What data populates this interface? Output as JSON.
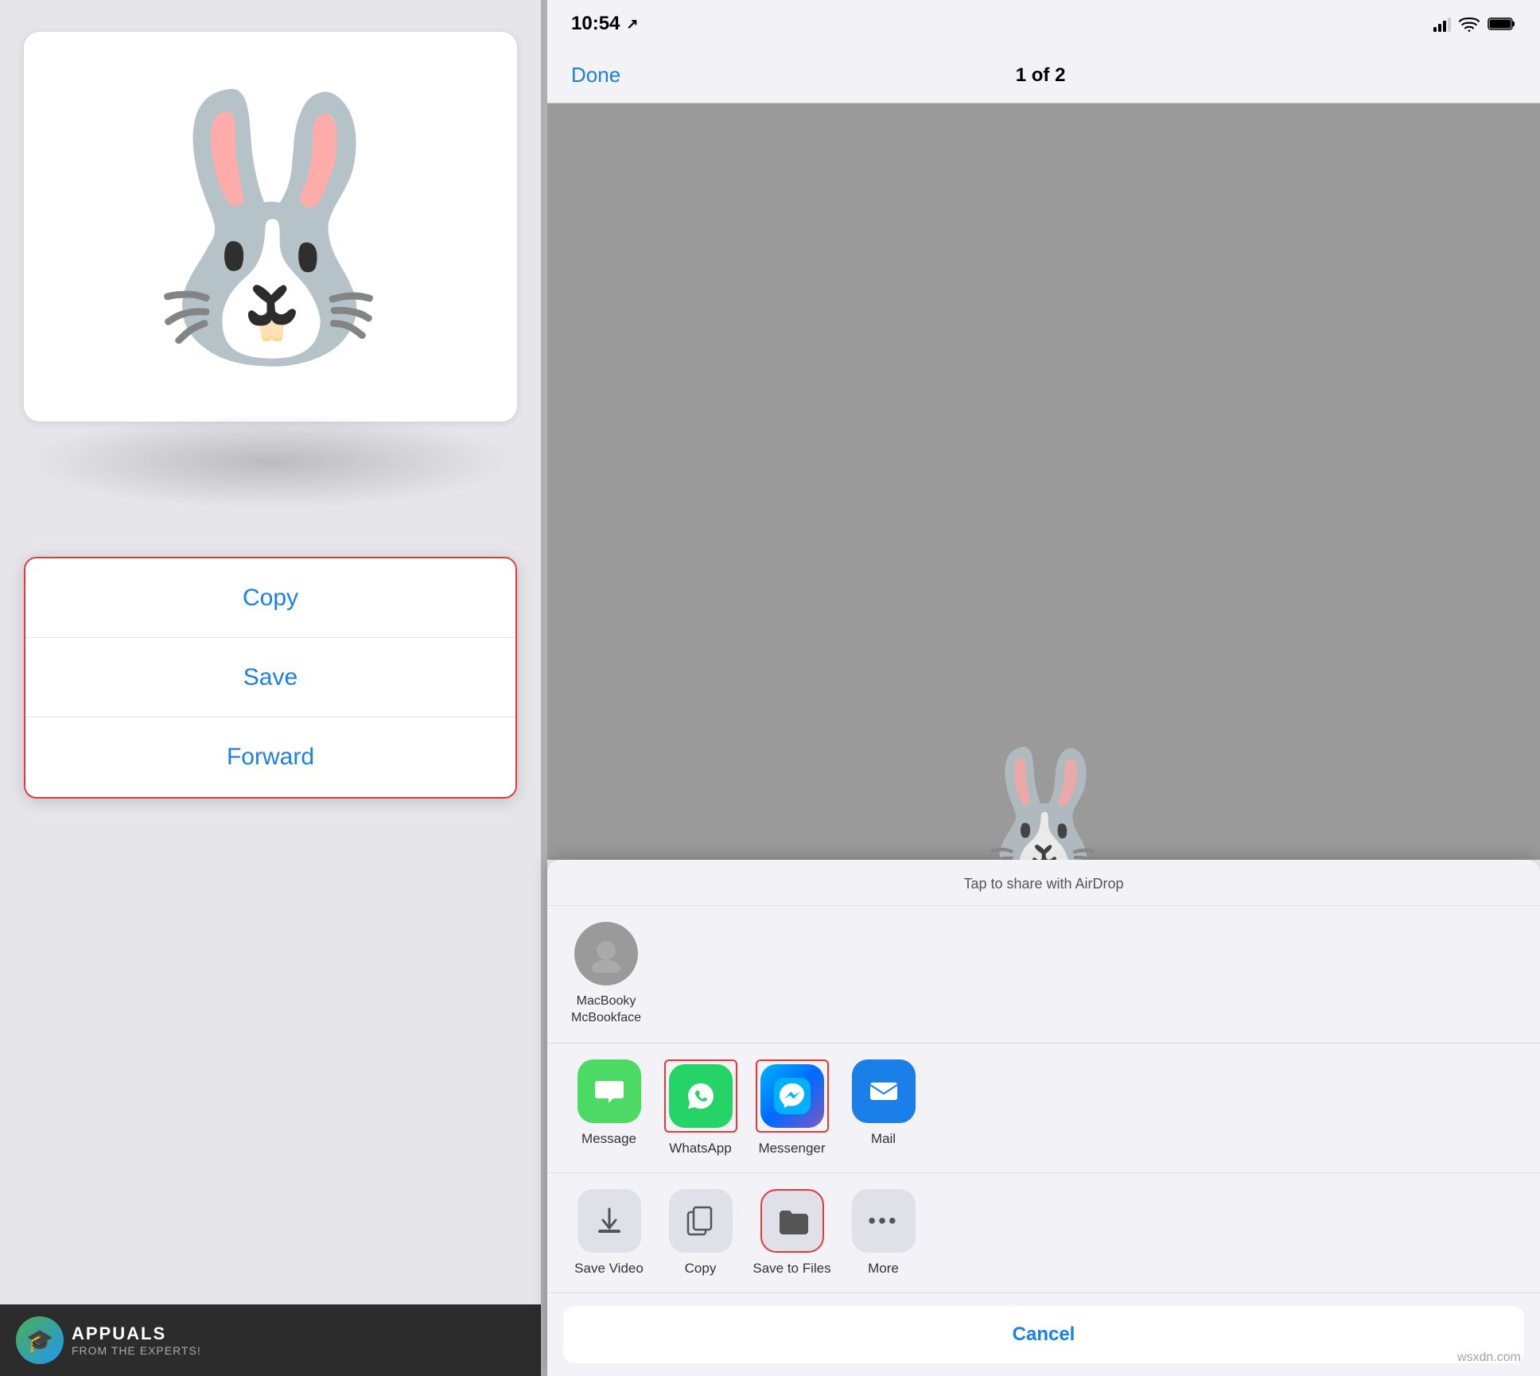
{
  "left": {
    "bunny_emoji": "🐰",
    "context_menu": {
      "items": [
        "Copy",
        "Save",
        "Forward"
      ]
    },
    "appuals": {
      "name": "APPUALS",
      "sub": "FROM THE EXPERTS!"
    }
  },
  "right": {
    "status_bar": {
      "time": "10:54",
      "direction_arrow": "↗",
      "wifi": "📶",
      "battery": "🔋"
    },
    "nav": {
      "done": "Done",
      "page_indicator": "1 of 2"
    },
    "airdrop_hint": "Tap to share with AirDrop",
    "contacts": [
      {
        "name": "MacBooky\nMcBookface",
        "initial": "👤"
      }
    ],
    "apps": [
      {
        "label": "Message",
        "type": "message",
        "emoji": "💬"
      },
      {
        "label": "WhatsApp",
        "type": "whatsapp",
        "emoji": "📱"
      },
      {
        "label": "Messenger",
        "type": "messenger",
        "emoji": "💬"
      },
      {
        "label": "Mail",
        "type": "mail",
        "emoji": "✉️"
      }
    ],
    "actions": [
      {
        "label": "Save Video",
        "icon": "save-video"
      },
      {
        "label": "Copy",
        "icon": "copy"
      },
      {
        "label": "Save to Files",
        "icon": "save-files"
      },
      {
        "label": "More",
        "icon": "more"
      }
    ],
    "cancel_label": "Cancel",
    "watermark": "wsxdn.com"
  }
}
